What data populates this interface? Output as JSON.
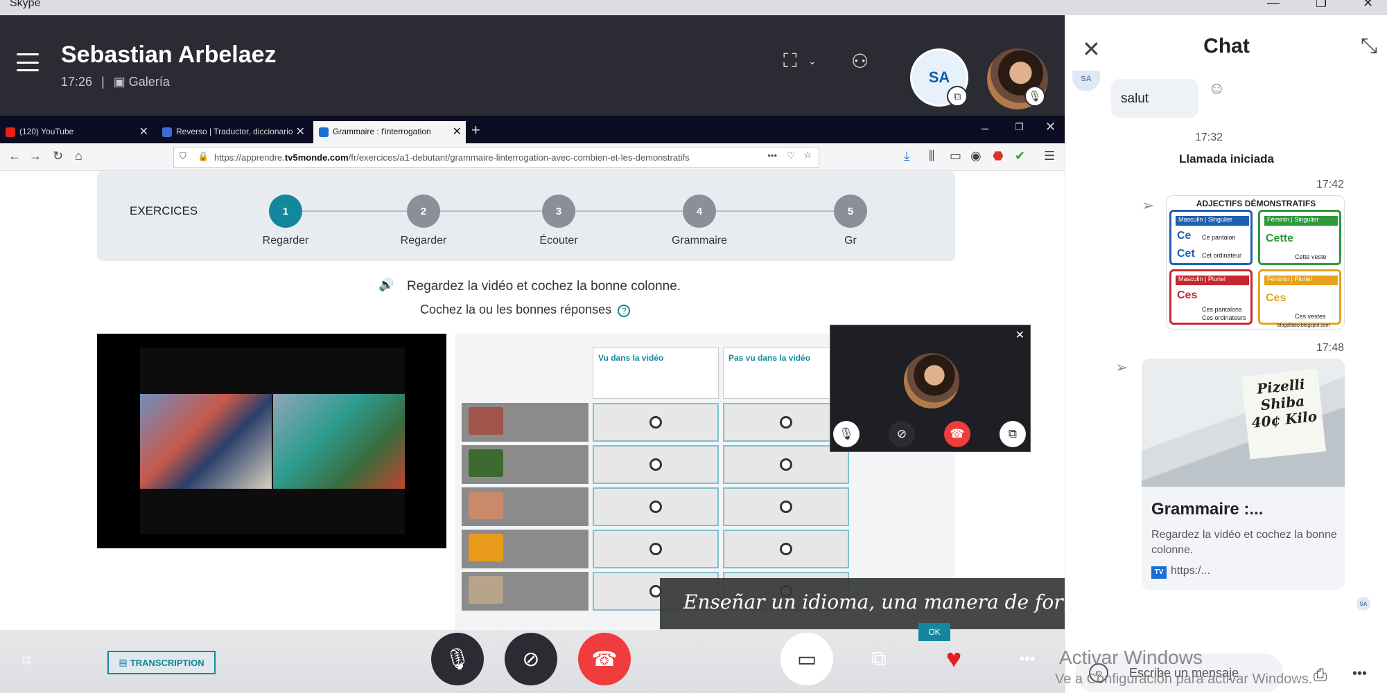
{
  "window": {
    "title": "Skype",
    "minimize": "—",
    "maximize": "❐",
    "close": "✕"
  },
  "call": {
    "caller_name": "Sebastian Arbelaez",
    "time": "17:26",
    "separator": "|",
    "view_mode": "Galería",
    "avatar_initials": "SA"
  },
  "browser": {
    "tabs": [
      {
        "label": "(120) YouTube",
        "icon_color": "#e62117"
      },
      {
        "label": "Reverso | Traductor, diccionario",
        "icon_color": "#3a6ed6"
      },
      {
        "label": "Grammaire : l'interrogation",
        "icon_color": "#1a6fd0"
      }
    ],
    "add_tab": "+",
    "url_prefix": "https://apprendre.",
    "url_domain": "tv5monde.com",
    "url_path": "/fr/exercices/a1-debutant/grammaire-linterrogation-avec-combien-et-les-demonstratifs"
  },
  "exercise": {
    "section_label": "EXERCICES",
    "steps": [
      {
        "num": "1",
        "label": "Regarder",
        "active": true
      },
      {
        "num": "2",
        "label": "Regarder",
        "active": false
      },
      {
        "num": "3",
        "label": "Écouter",
        "active": false
      },
      {
        "num": "4",
        "label": "Grammaire",
        "active": false
      },
      {
        "num": "5",
        "label": "Gr",
        "active": false
      }
    ],
    "instruction": "Regardez la vidéo et cochez la bonne colonne.",
    "instruction2": "Cochez la ou les bonnes réponses",
    "help": "?",
    "col1": "Vu dans la vidéo",
    "col2": "Pas vu dans la vidéo",
    "rows": [
      {
        "thumb_color": "#a0544a"
      },
      {
        "thumb_color": "#3d6a2e"
      },
      {
        "thumb_color": "#c98a6a"
      },
      {
        "thumb_color": "#e89a1a"
      },
      {
        "thumb_color": "#b8a48a"
      }
    ]
  },
  "caption": "Enseñar un idioma, una manera de formar y crecer- Paola Castillo",
  "controls": {
    "transcription": "TRANSCRIPTION",
    "ok": "OK",
    "more": "•••",
    "end_color": "#f03c3c"
  },
  "watermark": {
    "line1": "Activar Windows",
    "line2": "Ve a Configuración para activar Windows."
  },
  "chat": {
    "title": "Chat",
    "sa_initials": "SA",
    "msg1": "salut",
    "time1": "17:32",
    "system_msg": "Llamada iniciada",
    "time2": "17:42",
    "image_title": "ADJECTIFS DÉMONSTRATIFS",
    "adj": [
      {
        "head": "Masculin | Singulier",
        "word1": "Ce",
        "s1": "Ce pantalon",
        "word2": "Cet",
        "s2": "Cet ordinateur",
        "color": "#1d5fb4"
      },
      {
        "head": "Féminin | Singulier",
        "word1": "Cette",
        "s1": "Cette veste",
        "color": "#2e9a3a"
      },
      {
        "head": "Masculin | Pluriel",
        "word1": "Ces",
        "s1": "Ces pantalons",
        "s2": "Ces ordinateurs",
        "color": "#c6262e"
      },
      {
        "head": "Féminin | Pluriel",
        "word1": "Ces",
        "s1": "Ces vestes",
        "color": "#e5a21a"
      }
    ],
    "image_credit": "blogdilaeo.blogspot.com",
    "time3": "17:48",
    "sign_text": "Pizelli Shiba 40¢ Kilo",
    "link_title": "Grammaire :...",
    "link_desc": "Regardez la vidéo et cochez la bonne colonne.",
    "link_url": "https:/...",
    "input_placeholder": "Escribe un mensaje",
    "more": "•••"
  }
}
